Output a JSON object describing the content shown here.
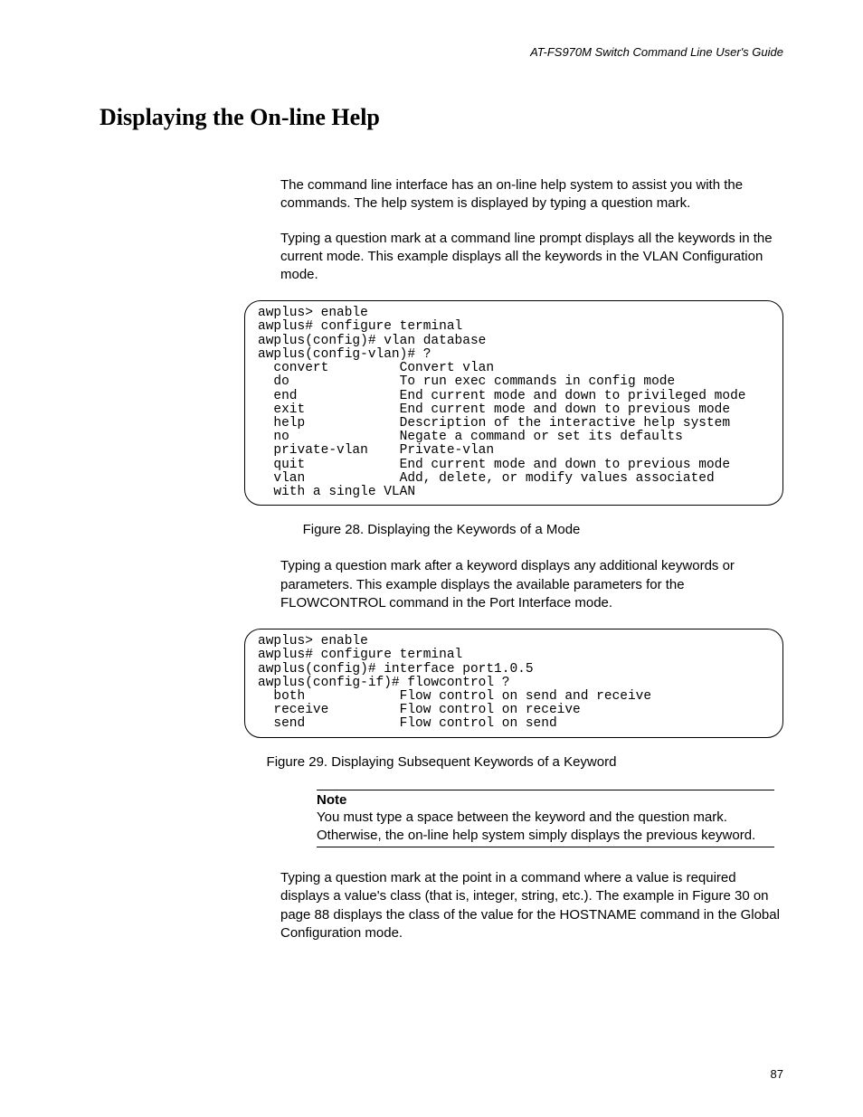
{
  "header": "AT-FS970M Switch Command Line User's Guide",
  "title": "Displaying the On-line Help",
  "para1": "The command line interface has an on-line help system to assist you with the commands. The help system is displayed by typing a question mark.",
  "para2": "Typing a question mark at a command line prompt displays all the keywords in the current mode. This example displays all the keywords in the VLAN Configuration mode.",
  "code1": "awplus> enable\nawplus# configure terminal\nawplus(config)# vlan database\nawplus(config-vlan)# ?\n  convert         Convert vlan\n  do              To run exec commands in config mode\n  end             End current mode and down to privileged mode\n  exit            End current mode and down to previous mode\n  help            Description of the interactive help system\n  no              Negate a command or set its defaults\n  private-vlan    Private-vlan\n  quit            End current mode and down to previous mode\n  vlan            Add, delete, or modify values associated\n  with a single VLAN",
  "caption1": "Figure 28. Displaying the Keywords of a Mode",
  "para3": "Typing a question mark after a keyword displays any additional keywords or parameters. This example displays the available parameters for the FLOWCONTROL command in the Port Interface mode.",
  "code2": "awplus> enable\nawplus# configure terminal\nawplus(config)# interface port1.0.5\nawplus(config-if)# flowcontrol ?\n  both            Flow control on send and receive\n  receive         Flow control on receive\n  send            Flow control on send",
  "caption2": "Figure 29. Displaying Subsequent Keywords of a Keyword",
  "note": {
    "title": "Note",
    "body": "You must type a space between the keyword and the question mark. Otherwise, the on-line help system simply displays the previous keyword."
  },
  "para4": "Typing a question mark at the point in a command where a value is required displays a value's class (that is, integer, string, etc.). The example in Figure 30 on page 88 displays the class of the value for the HOSTNAME command in the Global Configuration mode.",
  "pageNumber": "87"
}
